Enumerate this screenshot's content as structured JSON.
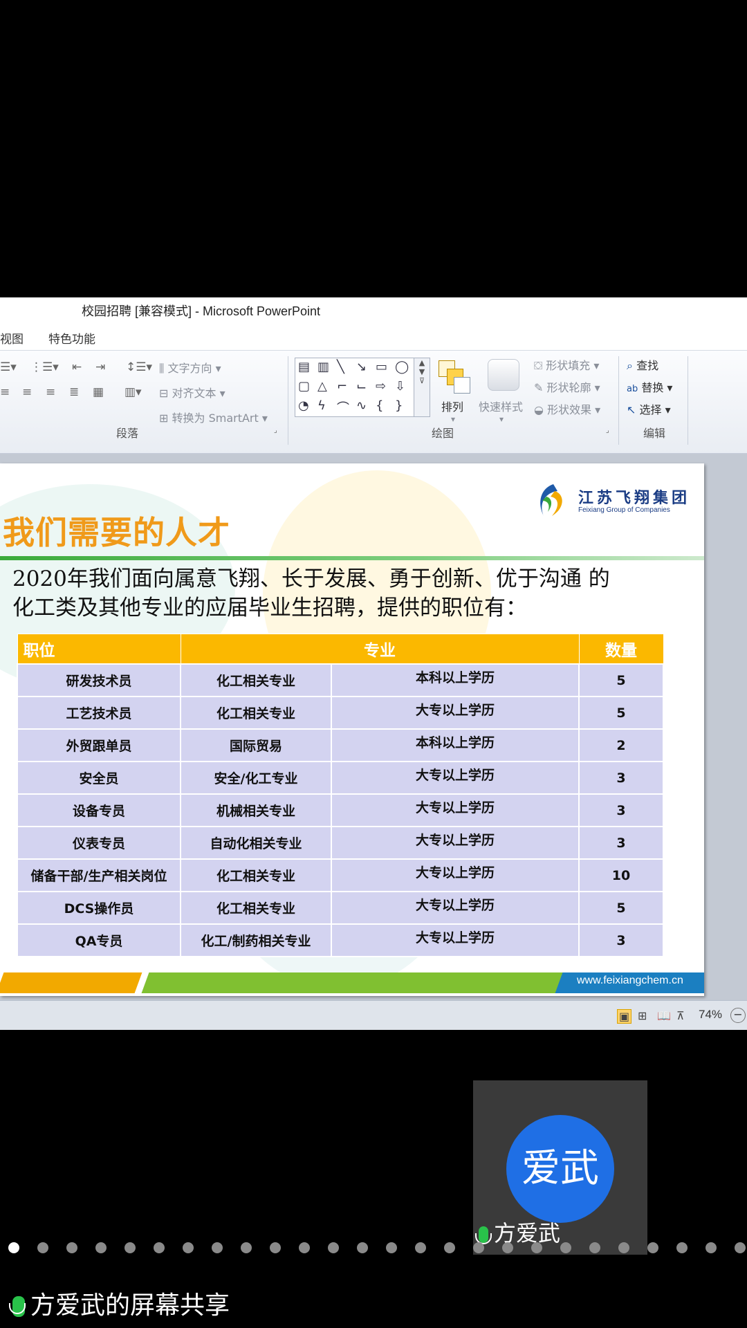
{
  "window": {
    "title": "校园招聘 [兼容模式] - Microsoft PowerPoint"
  },
  "menu": {
    "view": "视图",
    "special": "特色功能"
  },
  "ribbon": {
    "paragraph": {
      "text_direction": "文字方向",
      "align_text": "对齐文本",
      "smartart": "转换为 SmartArt",
      "label": "段落"
    },
    "drawing": {
      "arrange": "排列",
      "quick_styles": "快速样式",
      "shape_fill": "形状填充",
      "shape_outline": "形状轮廓",
      "shape_effects": "形状效果",
      "label": "绘图"
    },
    "editing": {
      "find": "查找",
      "replace": "替换",
      "select": "选择",
      "label": "编辑"
    }
  },
  "slide": {
    "title": "我们需要的人才",
    "logo_cn": "江苏飞翔集团",
    "logo_en": "Feixiang Group of Companies",
    "intro_line1": "2020年我们面向属意飞翔、长于发展、勇于创新、优于沟通 的",
    "intro_line2": "化工类及其他专业的应届毕业生招聘，提供的职位有：",
    "table": {
      "headers": {
        "position": "职位",
        "major": "专业",
        "count": "数量"
      },
      "rows": [
        {
          "position": "研发技术员",
          "major": "化工相关专业",
          "education": "本科以上学历",
          "count": "5"
        },
        {
          "position": "工艺技术员",
          "major": "化工相关专业",
          "education": "大专以上学历",
          "count": "5"
        },
        {
          "position": "外贸跟单员",
          "major": "国际贸易",
          "education": "本科以上学历",
          "count": "2"
        },
        {
          "position": "安全员",
          "major": "安全/化工专业",
          "education": "大专以上学历",
          "count": "3"
        },
        {
          "position": "设备专员",
          "major": "机械相关专业",
          "education": "大专以上学历",
          "count": "3"
        },
        {
          "position": "仪表专员",
          "major": "自动化相关专业",
          "education": "大专以上学历",
          "count": "3"
        },
        {
          "position": "储备干部/生产相关岗位",
          "major": "化工相关专业",
          "education": "大专以上学历",
          "count": "10"
        },
        {
          "position": "DCS操作员",
          "major": "化工相关专业",
          "education": "大专以上学历",
          "count": "5"
        },
        {
          "position": "QA专员",
          "major": "化工/制药相关专业",
          "education": "大专以上学历",
          "count": "3"
        }
      ]
    },
    "footer_url": "www.feixiangchem.cn"
  },
  "statusbar": {
    "zoom": "74%"
  },
  "meeting": {
    "avatar_text": "爱武",
    "participant_name": "方爱武",
    "share_label": "方爱武的屏幕共享",
    "page_count": 26,
    "active_page": 1
  }
}
